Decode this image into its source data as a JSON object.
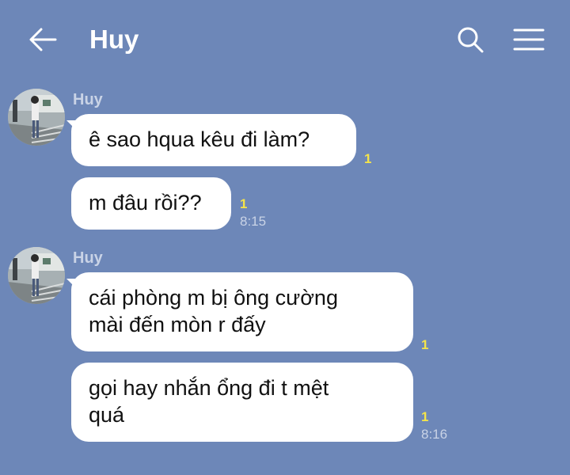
{
  "header": {
    "title": "Huy",
    "back_icon": "arrow-left-icon",
    "search_icon": "search-icon",
    "menu_icon": "hamburger-menu-icon"
  },
  "groups": [
    {
      "sender": "Huy",
      "messages": [
        {
          "text": "ê sao hqua kêu đi làm?",
          "unread": "1",
          "time": ""
        },
        {
          "text": "m đâu rồi??",
          "unread": "1",
          "time": "8:15"
        }
      ]
    },
    {
      "sender": "Huy",
      "messages": [
        {
          "text": "cái phòng m bị ông cường\nmài đến mòn r đấy",
          "unread": "1",
          "time": ""
        },
        {
          "text": "gọi hay nhắn ổng đi t mệt\nquá",
          "unread": "1",
          "time": "8:16"
        }
      ]
    }
  ],
  "colors": {
    "background": "#6d87b8",
    "bubble": "#ffffff",
    "unread": "#f4e44a",
    "meta_text": "#c9d3e6"
  }
}
